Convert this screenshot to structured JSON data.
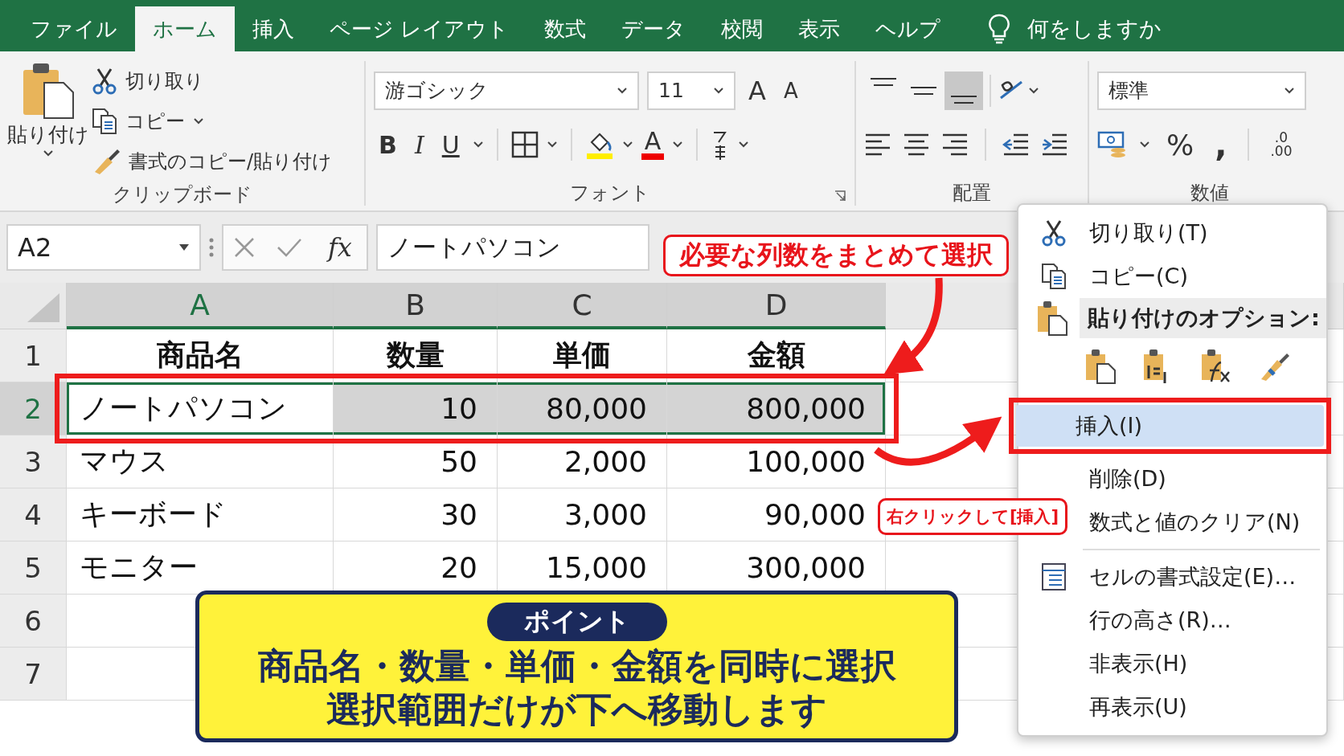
{
  "tabs": [
    {
      "label": "ファイル",
      "selected": false
    },
    {
      "label": "ホーム",
      "selected": true
    },
    {
      "label": "挿入",
      "selected": false
    },
    {
      "label": "ページ レイアウト",
      "selected": false
    },
    {
      "label": "数式",
      "selected": false
    },
    {
      "label": "データ",
      "selected": false
    },
    {
      "label": "校閲",
      "selected": false
    },
    {
      "label": "表示",
      "selected": false
    },
    {
      "label": "ヘルプ",
      "selected": false
    }
  ],
  "tell_me": "何をしますか",
  "ribbon": {
    "clipboard": {
      "paste": "貼り付け",
      "cut": "切り取り",
      "copy": "コピー",
      "format_painter": "書式のコピー/貼り付け",
      "label": "クリップボード"
    },
    "font": {
      "name": "游ゴシック",
      "size": "11",
      "grow": "A",
      "shrink": "A",
      "bold": "B",
      "italic": "I",
      "underline": "U",
      "font_color": "A",
      "label": "フォント"
    },
    "alignment": {
      "label": "配置",
      "vertical_buttons": [
        {
          "selected": false
        },
        {
          "selected": false
        },
        {
          "selected": true
        }
      ]
    },
    "number": {
      "format": "標準",
      "percent": "%",
      "comma": ",",
      "decimal_top": ".0",
      "decimal_bottom": ".00",
      "label": "数値"
    }
  },
  "formula_bar": {
    "name_box": "A2",
    "fx": "fx",
    "value": "ノートパソコン"
  },
  "sheet": {
    "columns": [
      {
        "label": "A",
        "selected": true
      },
      {
        "label": "B",
        "selected": true
      },
      {
        "label": "C",
        "selected": true
      },
      {
        "label": "D",
        "selected": true
      }
    ],
    "rows": [
      {
        "number": "1",
        "kind": "header",
        "selected": false,
        "cells": [
          "商品名",
          "数量",
          "単価",
          "金額"
        ]
      },
      {
        "number": "2",
        "kind": "data",
        "selected": true,
        "cells": [
          "ノートパソコン",
          "10",
          "80,000",
          "800,000"
        ]
      },
      {
        "number": "3",
        "kind": "data",
        "selected": false,
        "cells": [
          "マウス",
          "50",
          "2,000",
          "100,000"
        ]
      },
      {
        "number": "4",
        "kind": "data",
        "selected": false,
        "cells": [
          "キーボード",
          "30",
          "3,000",
          "90,000"
        ]
      },
      {
        "number": "5",
        "kind": "data",
        "selected": false,
        "cells": [
          "モニター",
          "20",
          "15,000",
          "300,000"
        ]
      },
      {
        "number": "6",
        "kind": "empty",
        "selected": false
      },
      {
        "number": "7",
        "kind": "empty",
        "selected": false
      }
    ]
  },
  "context_menu": {
    "items": [
      {
        "kind": "command",
        "label": "切り取り(T)",
        "selected": false
      },
      {
        "kind": "command",
        "label": "コピー(C)",
        "selected": false
      },
      {
        "kind": "heading",
        "label": "貼り付けのオプション:"
      },
      {
        "kind": "paste_icons"
      },
      {
        "kind": "command",
        "label": "挿入(I)",
        "selected": true
      },
      {
        "kind": "command",
        "label": "削除(D)",
        "selected": false
      },
      {
        "kind": "command",
        "label": "数式と値のクリア(N)",
        "selected": false
      },
      {
        "kind": "separator"
      },
      {
        "kind": "command",
        "label": "セルの書式設定(E)…",
        "selected": false
      },
      {
        "kind": "command",
        "label": "行の高さ(R)…",
        "selected": false
      },
      {
        "kind": "command",
        "label": "非表示(H)",
        "selected": false
      },
      {
        "kind": "command",
        "label": "再表示(U)",
        "selected": false
      }
    ]
  },
  "annotations": {
    "select_callout": "必要な列数をまとめて選択",
    "click_callout": "右クリックして[挿入]",
    "point": {
      "badge": "ポイント",
      "lines": [
        "商品名・数量・単価・金額を同時に選択",
        "選択範囲だけが下へ移動します"
      ]
    }
  }
}
